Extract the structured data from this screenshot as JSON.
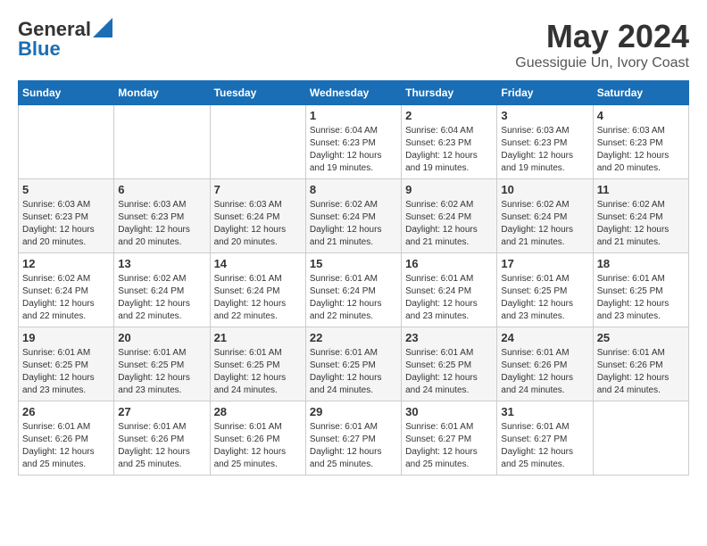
{
  "logo": {
    "line1": "General",
    "line2": "Blue"
  },
  "header": {
    "month": "May 2024",
    "location": "Guessiguie Un, Ivory Coast"
  },
  "weekdays": [
    "Sunday",
    "Monday",
    "Tuesday",
    "Wednesday",
    "Thursday",
    "Friday",
    "Saturday"
  ],
  "weeks": [
    [
      {
        "day": "",
        "info": ""
      },
      {
        "day": "",
        "info": ""
      },
      {
        "day": "",
        "info": ""
      },
      {
        "day": "1",
        "info": "Sunrise: 6:04 AM\nSunset: 6:23 PM\nDaylight: 12 hours\nand 19 minutes."
      },
      {
        "day": "2",
        "info": "Sunrise: 6:04 AM\nSunset: 6:23 PM\nDaylight: 12 hours\nand 19 minutes."
      },
      {
        "day": "3",
        "info": "Sunrise: 6:03 AM\nSunset: 6:23 PM\nDaylight: 12 hours\nand 19 minutes."
      },
      {
        "day": "4",
        "info": "Sunrise: 6:03 AM\nSunset: 6:23 PM\nDaylight: 12 hours\nand 20 minutes."
      }
    ],
    [
      {
        "day": "5",
        "info": "Sunrise: 6:03 AM\nSunset: 6:23 PM\nDaylight: 12 hours\nand 20 minutes."
      },
      {
        "day": "6",
        "info": "Sunrise: 6:03 AM\nSunset: 6:23 PM\nDaylight: 12 hours\nand 20 minutes."
      },
      {
        "day": "7",
        "info": "Sunrise: 6:03 AM\nSunset: 6:24 PM\nDaylight: 12 hours\nand 20 minutes."
      },
      {
        "day": "8",
        "info": "Sunrise: 6:02 AM\nSunset: 6:24 PM\nDaylight: 12 hours\nand 21 minutes."
      },
      {
        "day": "9",
        "info": "Sunrise: 6:02 AM\nSunset: 6:24 PM\nDaylight: 12 hours\nand 21 minutes."
      },
      {
        "day": "10",
        "info": "Sunrise: 6:02 AM\nSunset: 6:24 PM\nDaylight: 12 hours\nand 21 minutes."
      },
      {
        "day": "11",
        "info": "Sunrise: 6:02 AM\nSunset: 6:24 PM\nDaylight: 12 hours\nand 21 minutes."
      }
    ],
    [
      {
        "day": "12",
        "info": "Sunrise: 6:02 AM\nSunset: 6:24 PM\nDaylight: 12 hours\nand 22 minutes."
      },
      {
        "day": "13",
        "info": "Sunrise: 6:02 AM\nSunset: 6:24 PM\nDaylight: 12 hours\nand 22 minutes."
      },
      {
        "day": "14",
        "info": "Sunrise: 6:01 AM\nSunset: 6:24 PM\nDaylight: 12 hours\nand 22 minutes."
      },
      {
        "day": "15",
        "info": "Sunrise: 6:01 AM\nSunset: 6:24 PM\nDaylight: 12 hours\nand 22 minutes."
      },
      {
        "day": "16",
        "info": "Sunrise: 6:01 AM\nSunset: 6:24 PM\nDaylight: 12 hours\nand 23 minutes."
      },
      {
        "day": "17",
        "info": "Sunrise: 6:01 AM\nSunset: 6:25 PM\nDaylight: 12 hours\nand 23 minutes."
      },
      {
        "day": "18",
        "info": "Sunrise: 6:01 AM\nSunset: 6:25 PM\nDaylight: 12 hours\nand 23 minutes."
      }
    ],
    [
      {
        "day": "19",
        "info": "Sunrise: 6:01 AM\nSunset: 6:25 PM\nDaylight: 12 hours\nand 23 minutes."
      },
      {
        "day": "20",
        "info": "Sunrise: 6:01 AM\nSunset: 6:25 PM\nDaylight: 12 hours\nand 23 minutes."
      },
      {
        "day": "21",
        "info": "Sunrise: 6:01 AM\nSunset: 6:25 PM\nDaylight: 12 hours\nand 24 minutes."
      },
      {
        "day": "22",
        "info": "Sunrise: 6:01 AM\nSunset: 6:25 PM\nDaylight: 12 hours\nand 24 minutes."
      },
      {
        "day": "23",
        "info": "Sunrise: 6:01 AM\nSunset: 6:25 PM\nDaylight: 12 hours\nand 24 minutes."
      },
      {
        "day": "24",
        "info": "Sunrise: 6:01 AM\nSunset: 6:26 PM\nDaylight: 12 hours\nand 24 minutes."
      },
      {
        "day": "25",
        "info": "Sunrise: 6:01 AM\nSunset: 6:26 PM\nDaylight: 12 hours\nand 24 minutes."
      }
    ],
    [
      {
        "day": "26",
        "info": "Sunrise: 6:01 AM\nSunset: 6:26 PM\nDaylight: 12 hours\nand 25 minutes."
      },
      {
        "day": "27",
        "info": "Sunrise: 6:01 AM\nSunset: 6:26 PM\nDaylight: 12 hours\nand 25 minutes."
      },
      {
        "day": "28",
        "info": "Sunrise: 6:01 AM\nSunset: 6:26 PM\nDaylight: 12 hours\nand 25 minutes."
      },
      {
        "day": "29",
        "info": "Sunrise: 6:01 AM\nSunset: 6:27 PM\nDaylight: 12 hours\nand 25 minutes."
      },
      {
        "day": "30",
        "info": "Sunrise: 6:01 AM\nSunset: 6:27 PM\nDaylight: 12 hours\nand 25 minutes."
      },
      {
        "day": "31",
        "info": "Sunrise: 6:01 AM\nSunset: 6:27 PM\nDaylight: 12 hours\nand 25 minutes."
      },
      {
        "day": "",
        "info": ""
      }
    ]
  ]
}
